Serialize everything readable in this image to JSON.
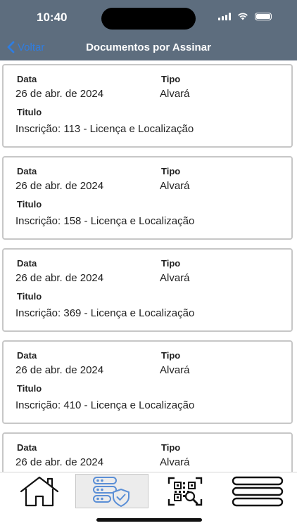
{
  "status_bar": {
    "time": "10:40"
  },
  "nav": {
    "back_label": "Voltar",
    "title": "Documentos por Assinar"
  },
  "labels": {
    "data": "Data",
    "tipo": "Tipo",
    "titulo": "Titulo"
  },
  "documents": [
    {
      "date": "26 de abr. de 2024",
      "type": "Alvará",
      "title": "Inscrição: 113 - Licença e Localização"
    },
    {
      "date": "26 de abr. de 2024",
      "type": "Alvará",
      "title": "Inscrição: 158 - Licença e Localização"
    },
    {
      "date": "26 de abr. de 2024",
      "type": "Alvará",
      "title": "Inscrição: 369 - Licença e Localização"
    },
    {
      "date": "26 de abr. de 2024",
      "type": "Alvará",
      "title": "Inscrição: 410 - Licença e Localização"
    },
    {
      "date": "26 de abr. de 2024",
      "type": "Alvará",
      "title": ""
    }
  ],
  "tabs": [
    {
      "icon": "home-icon",
      "active": false
    },
    {
      "icon": "server-shield-icon",
      "active": true
    },
    {
      "icon": "qr-search-icon",
      "active": false
    },
    {
      "icon": "menu-icon",
      "active": false
    }
  ],
  "colors": {
    "header_bg": "#5d6d7e",
    "accent": "#2f7de1",
    "card_border": "#c7c7c7",
    "icon_blue": "#5b8fd6"
  }
}
